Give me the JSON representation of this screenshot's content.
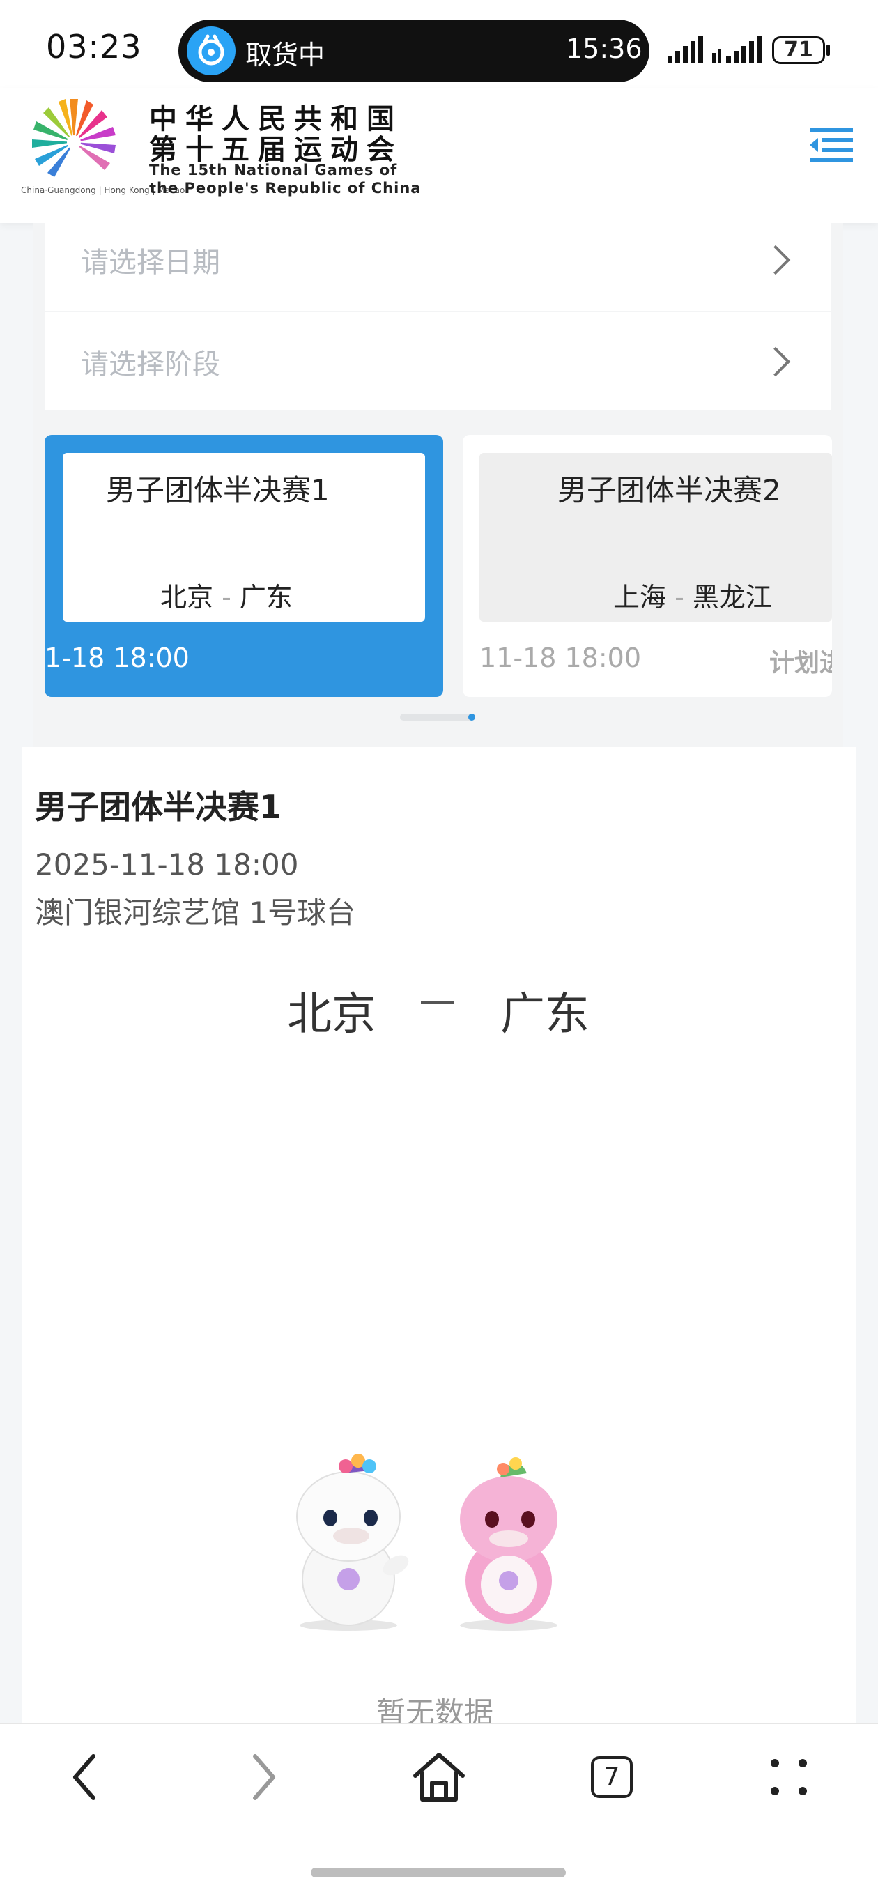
{
  "status_bar": {
    "time": "03:23",
    "pill_label": "取货中",
    "pill_time": "15:36",
    "battery": "71"
  },
  "header": {
    "logo_caption": "China·Guangdong | Hong Kong | Macao",
    "title_line1": "中华人民共和国",
    "title_line2": "第十五届运动会",
    "title_en_line1": "The 15th National Games of",
    "title_en_line2": "the People's Republic of China",
    "menu_icon": "menu-collapse-icon"
  },
  "filters": {
    "date_placeholder": "请选择日期",
    "stage_placeholder": "请选择阶段"
  },
  "match_cards": [
    {
      "title": "男子团体半决赛1",
      "home": "北京",
      "dash": "-",
      "away": "广东",
      "time": "1-18  18:00",
      "selected": true
    },
    {
      "title": "男子团体半决赛2",
      "home": "上海",
      "dash": "-",
      "away": "黑龙江",
      "time": "11-18  18:00",
      "status": "计划进",
      "selected": false
    }
  ],
  "detail": {
    "title": "男子团体半决赛1",
    "datetime": "2025-11-18 18:00",
    "venue": "澳门银河综艺馆 1号球台",
    "home": "北京",
    "away": "广东",
    "empty_text": "暂无数据"
  },
  "bottom_nav": {
    "tabs_count": "7"
  },
  "colors": {
    "accent": "#2f95e0",
    "placeholder": "#b8bcc2"
  }
}
